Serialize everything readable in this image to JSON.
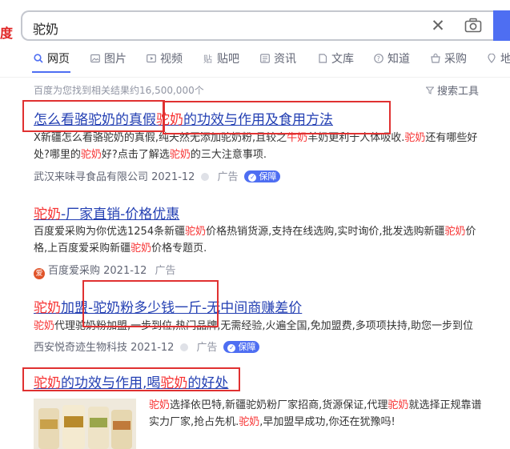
{
  "logo_fragment": "度",
  "search": {
    "query": "驼奶"
  },
  "tabs": [
    {
      "label": "网页",
      "icon": "search-icon"
    },
    {
      "label": "图片",
      "icon": "image-icon"
    },
    {
      "label": "视频",
      "icon": "video-icon"
    },
    {
      "label": "贴吧",
      "icon": "tieba-icon"
    },
    {
      "label": "资讯",
      "icon": "news-icon"
    },
    {
      "label": "文库",
      "icon": "document-icon"
    },
    {
      "label": "知道",
      "icon": "question-icon"
    },
    {
      "label": "采购",
      "icon": "shop-icon"
    },
    {
      "label": "地",
      "icon": "map-icon"
    }
  ],
  "results_count": "百度为您找到相关结果约16,500,000个",
  "search_tools": "搜索工具",
  "results": [
    {
      "title_a": "怎么看骆驼奶的真假",
      "title_b_red": "驼奶",
      "title_b_rest": "的功效与作用及食用方法",
      "snippet_line1_a": "X新疆怎么看骆驼奶的真假,纯天然无添加驼奶粉,且较之",
      "snippet_line1_red1": "牛奶",
      "snippet_line1_b": "羊奶更利于人体吸收.",
      "snippet_line1_red2": "驼奶",
      "snippet_line1_c": "还有哪些好",
      "snippet_line2_a": "处?哪里的",
      "snippet_line2_red1": "驼奶",
      "snippet_line2_b": "好?点击了解选",
      "snippet_line2_red2": "驼奶",
      "snippet_line2_c": "的三大注意事项.",
      "source": "武汉来味寻食品有限公司 2021-12",
      "ad": "广告",
      "badge": "保障"
    },
    {
      "title_red": "驼奶",
      "title_rest": "-厂家直销-价格优惠",
      "line1_a": "百度爱采购为你优选1254条新疆",
      "line1_red": "驼奶",
      "line1_b": "价格热销货源,支持在线选购,实时询价,批发选购新疆",
      "line1_red2": "驼奶",
      "line1_c": "价",
      "line2_a": "格,上百度爱采购新疆",
      "line2_red": "驼奶",
      "line2_b": "价格专题页.",
      "source": "百度爱采购 2021-12",
      "ad": "广告"
    },
    {
      "title_red": "驼奶",
      "title_rest": "加盟-驼奶粉多少钱一斤-无中间商赚差价",
      "line1_red": "驼奶",
      "line1_rest": "代理驼奶粉加盟,一步到位,热门品牌,无需经验,火遍全国,免加盟费,多项项扶持,助您一步到位",
      "source": "西安悦奇迹生物科技 2021-12",
      "ad": "广告",
      "badge": "保障"
    },
    {
      "title_red1": "驼奶",
      "title_mid": "的功效与作用,喝",
      "title_red2": "驼奶",
      "title_end": "的好处",
      "line1_red": "驼奶",
      "line1_rest": "选择依巴特,新疆驼奶粉厂家招商,货源保证,代理",
      "line1_red2": "驼奶",
      "line1_end": "就选择正规靠谱",
      "line2_a": "实力厂家,抢占先机.",
      "line2_red": "驼奶",
      "line2_b": ",早加盟早成功,你还在犹豫吗!"
    }
  ],
  "colors": {
    "accent": "#4e6ef2",
    "link": "#2440b3",
    "highlight": "#f73131",
    "annotation": "#e03131"
  }
}
